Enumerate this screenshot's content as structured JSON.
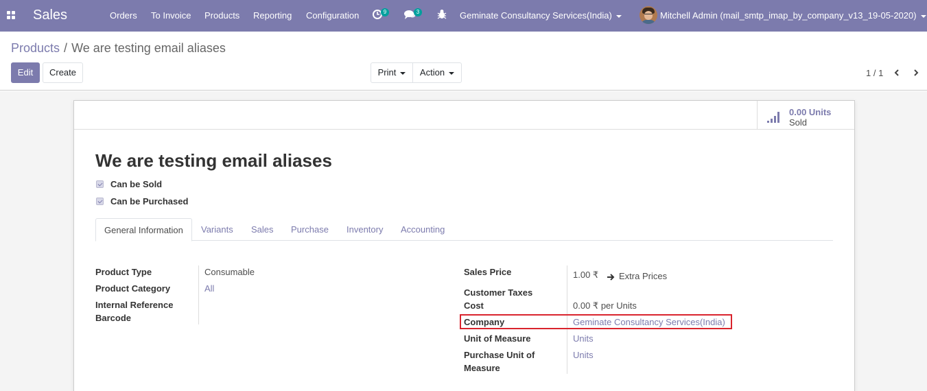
{
  "navbar": {
    "app_name": "Sales",
    "menus": [
      "Orders",
      "To Invoice",
      "Products",
      "Reporting",
      "Configuration"
    ],
    "activity_count": "9",
    "message_count": "3",
    "company": "Geminate Consultancy Services(India)",
    "user": "Mitchell Admin (mail_smtp_imap_by_company_v13_19-05-2020)"
  },
  "breadcrumb": {
    "parent": "Products",
    "separator": "/",
    "current": "We are testing email aliases"
  },
  "buttons": {
    "edit": "Edit",
    "create": "Create",
    "print": "Print",
    "action": "Action"
  },
  "pager": {
    "value": "1 / 1"
  },
  "stat": {
    "value": "0.00 Units",
    "label": "Sold"
  },
  "product": {
    "name": "We are testing email aliases",
    "can_be_sold": "Can be Sold",
    "can_be_purchased": "Can be Purchased"
  },
  "tabs": [
    "General Information",
    "Variants",
    "Sales",
    "Purchase",
    "Inventory",
    "Accounting"
  ],
  "left_fields": {
    "product_type_label": "Product Type",
    "product_type_value": "Consumable",
    "category_label": "Product Category",
    "category_value": "All",
    "internal_ref_label": "Internal Reference",
    "barcode_label": "Barcode"
  },
  "right_fields": {
    "sales_price_label": "Sales Price",
    "sales_price_value": "1.00 ₹",
    "extra_prices": "Extra Prices",
    "customer_taxes_label": "Customer Taxes",
    "cost_label": "Cost",
    "cost_value": "0.00 ₹",
    "cost_suffix": "per Units",
    "company_label": "Company",
    "company_value": "Geminate Consultancy Services(India)",
    "uom_label": "Unit of Measure",
    "uom_value": "Units",
    "purchase_uom_label_1": "Purchase Unit of",
    "purchase_uom_label_2": "Measure",
    "purchase_uom_value": "Units"
  },
  "colors": {
    "brand": "#7c7bad",
    "highlight": "#d9232d",
    "badge": "#00a09d"
  }
}
